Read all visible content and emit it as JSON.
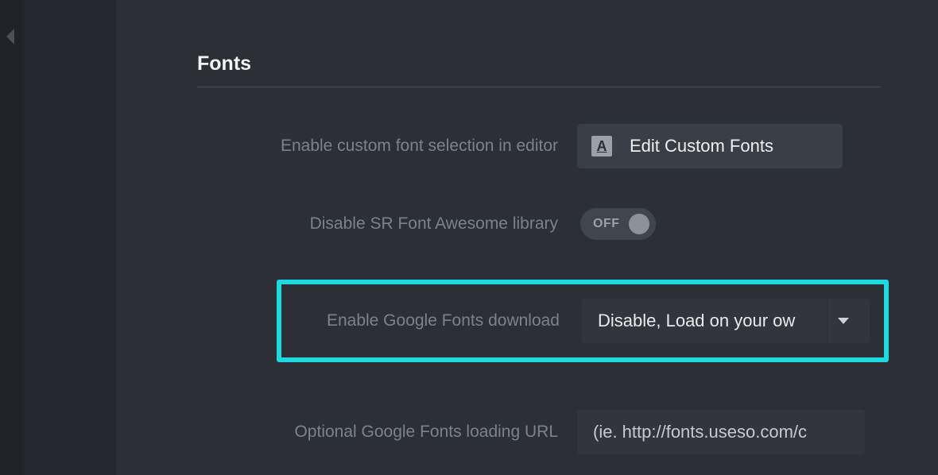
{
  "section": {
    "title": "Fonts"
  },
  "rows": {
    "customFont": {
      "label": "Enable custom font selection in editor",
      "button": "Edit Custom Fonts",
      "iconLetter": "A"
    },
    "disableSR": {
      "label": "Disable SR Font Awesome library",
      "toggle": "OFF"
    },
    "googleFonts": {
      "label": "Enable Google Fonts download",
      "selected": "Disable, Load on your ow"
    },
    "optionalUrl": {
      "label": "Optional Google Fonts loading URL",
      "placeholder": "(ie. http://fonts.useso.com/c"
    }
  }
}
